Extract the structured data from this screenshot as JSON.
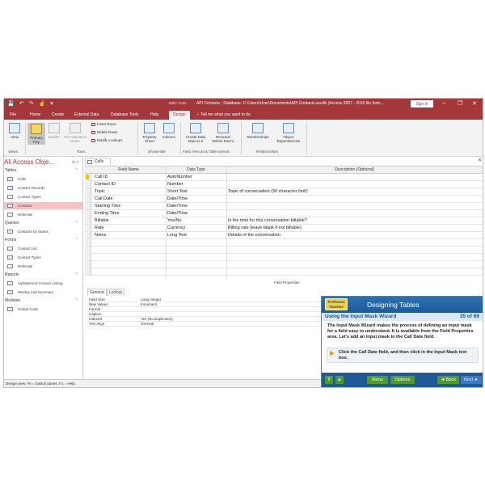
{
  "window": {
    "title": "API Contacts : Database- C:\\Users\\User\\Documents\\API Contacts.accdb (Access 2007 - 2016 file form...",
    "context_tab_group": "Table Tools",
    "sign_in": "Sign in",
    "controls": {
      "minimize": "─",
      "restore": "❐",
      "close": "✕"
    }
  },
  "qat": {
    "save": "💾",
    "undo": "↶",
    "redo": "↷",
    "touch": "☝",
    "more": "▾"
  },
  "tabs": [
    "File",
    "Home",
    "Create",
    "External Data",
    "Database Tools",
    "Help",
    "Design"
  ],
  "active_tab": "Design",
  "tell_me": "Tell me what you want to do",
  "ribbon": {
    "view": "View",
    "primary_key": "Primary Key",
    "builder": "Builder",
    "test_validation": "Test Validation Rules",
    "insert_rows": "Insert Rows",
    "delete_rows": "Delete Rows",
    "modify_lookups": "Modify Lookups",
    "property_sheet": "Property Sheet",
    "indexes": "Indexes",
    "create_data_macros": "Create Data Macros ▾",
    "rename_delete_macro": "Rename/ Delete Macro",
    "relationships": "Relationships",
    "object_dependencies": "Object Dependencies",
    "groups": {
      "views": "Views",
      "tools": "Tools",
      "show_hide": "Show/Hide",
      "field_record_table_events": "Field, Record & Table Events",
      "relationships": "Relationships"
    }
  },
  "nav": {
    "title": "All Access Obje...",
    "sections": [
      {
        "label": "Tables",
        "items": [
          "Calls",
          "Contact Records",
          "Contact Types",
          "Contacts",
          "Referrals"
        ]
      },
      {
        "label": "Queries",
        "items": [
          "Contacts by Status"
        ]
      },
      {
        "label": "Forms",
        "items": [
          "Contact List",
          "Contact Types",
          "Referrals"
        ]
      },
      {
        "label": "Reports",
        "items": [
          "Alphabetical Contact Listing",
          "Weekly Call Summary"
        ]
      },
      {
        "label": "Modules",
        "items": [
          "Global Code"
        ]
      }
    ],
    "selected": "Contacts"
  },
  "doc_tab": "Calls",
  "table": {
    "headers": [
      "Field Name",
      "Data Type",
      "Description (Optional)"
    ],
    "rows": [
      {
        "name": "Call ID",
        "type": "AutoNumber",
        "desc": ""
      },
      {
        "name": "Contact ID",
        "type": "Number",
        "desc": ""
      },
      {
        "name": "Topic",
        "type": "Short Text",
        "desc": "Topic of conversation (30 character limit)"
      },
      {
        "name": "Call Date",
        "type": "Date/Time",
        "desc": ""
      },
      {
        "name": "Starting Time",
        "type": "Date/Time",
        "desc": ""
      },
      {
        "name": "Ending Time",
        "type": "Date/Time",
        "desc": ""
      },
      {
        "name": "Billable",
        "type": "Yes/No",
        "desc": "Is the time for this conversation billable?"
      },
      {
        "name": "Rate",
        "type": "Currency",
        "desc": "Billing rate (leave blank if not billable)"
      },
      {
        "name": "Notes",
        "type": "Long Text",
        "desc": "Details of the conversation"
      }
    ]
  },
  "field_properties": {
    "label": "Field Properties",
    "tabs": [
      "General",
      "Lookup"
    ],
    "rows": [
      {
        "name": "Field Size",
        "value": "Long Integer"
      },
      {
        "name": "New Values",
        "value": "Increment"
      },
      {
        "name": "Format",
        "value": ""
      },
      {
        "name": "Caption",
        "value": ""
      },
      {
        "name": "Indexed",
        "value": "Yes (No Duplicates)"
      },
      {
        "name": "Text Align",
        "value": "General"
      }
    ]
  },
  "status": "Design view.  F6 = Switch panes.  F1 = Help.",
  "tutorial": {
    "logo": "Professor Teaches",
    "title": "Designing Tables",
    "subtitle": "Using the Input Mask Wizard",
    "page": "35 of 69",
    "body": "The Input Mask Wizard makes the process of defining an input mask for a field easy to understand. It is available from the Field Properties area. Let's add an input mask to the Call Date field.",
    "instruction": "Click the Call Date field, and then click in the Input Mask text box.",
    "buttons": {
      "t": "T",
      "up": "▲",
      "menu": "Menu",
      "options": "Options",
      "back": "◄ Back",
      "next": "Next ►"
    }
  }
}
